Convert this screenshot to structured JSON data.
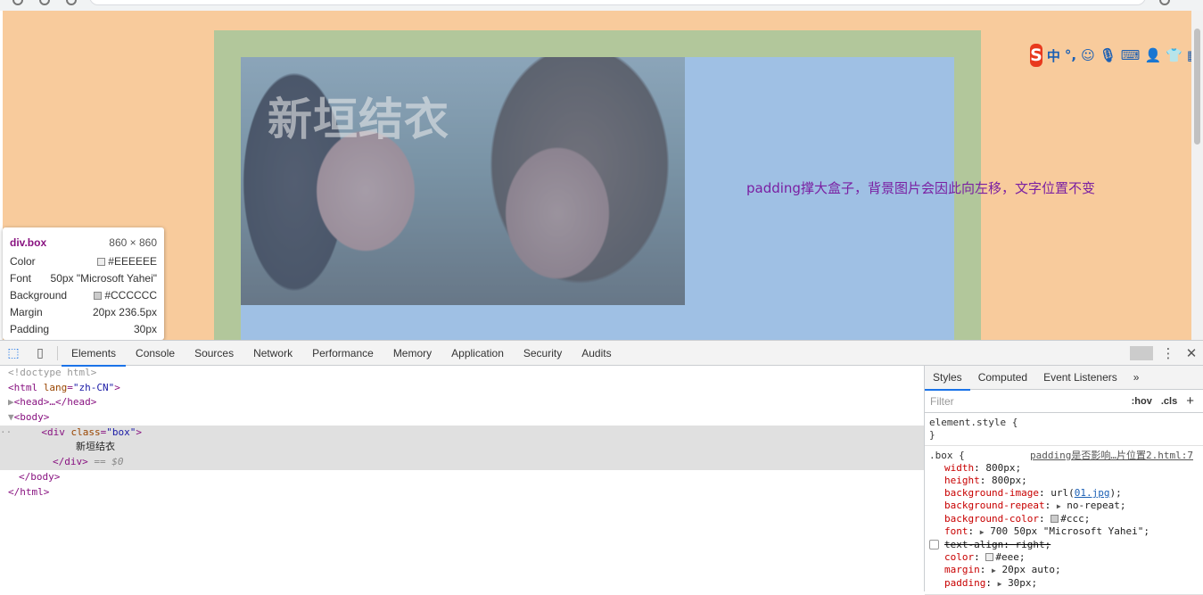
{
  "page": {
    "box_text": "新垣结衣",
    "caption": "padding撑大盒子，背景图片会因此向左移，文字位置不变"
  },
  "ime": {
    "logo": "S",
    "mode": "中",
    "punct": "°,"
  },
  "tooltip": {
    "selector": "div.box",
    "size": "860 × 860",
    "rows": [
      {
        "label": "Color",
        "value": "#EEEEEE",
        "swatch": "#eeeeee"
      },
      {
        "label": "Font",
        "value": "50px \"Microsoft Yahei\""
      },
      {
        "label": "Background",
        "value": "#CCCCCC",
        "swatch": "#cccccc"
      },
      {
        "label": "Margin",
        "value": "20px 236.5px"
      },
      {
        "label": "Padding",
        "value": "30px"
      }
    ]
  },
  "devtools": {
    "tabs": [
      "Elements",
      "Console",
      "Sources",
      "Network",
      "Performance",
      "Memory",
      "Application",
      "Security",
      "Audits"
    ],
    "active_tab": "Elements",
    "elements": {
      "doctype": "<!doctype html>",
      "html_open": "<html",
      "html_lang_attr": "lang",
      "html_lang_val": "\"zh-CN\"",
      "head": "<head>…</head>",
      "body_open": "<body>",
      "div_open": "<div",
      "div_class_attr": "class",
      "div_class_val": "\"box\"",
      "div_text": "新垣结衣",
      "div_close": "</div>",
      "eq_marker": "== $0",
      "body_close": "</body>",
      "html_close": "</html>"
    },
    "styles": {
      "tabs": [
        "Styles",
        "Computed",
        "Event Listeners"
      ],
      "more": "»",
      "filter_placeholder": "Filter",
      "hov": ":hov",
      "cls": ".cls",
      "plus": "+",
      "element_style": "element.style {",
      "close_brace": "}",
      "rule_selector": ".box {",
      "rule_source": "padding是否影响…片位置2.html:7",
      "props": [
        {
          "name": "width",
          "value": "800px;"
        },
        {
          "name": "height",
          "value": "800px;"
        },
        {
          "name": "background-image",
          "value_pre": "url(",
          "value_link": "01.jpg",
          "value_post": ");"
        },
        {
          "name": "background-repeat",
          "value": "no-repeat;",
          "tri": true
        },
        {
          "name": "background-color",
          "value": "#ccc;",
          "swatch": "#cccccc"
        },
        {
          "name": "font",
          "value": "700 50px \"Microsoft Yahei\";",
          "tri": true
        },
        {
          "name": "text-align",
          "value": "right;",
          "disabled": true
        },
        {
          "name": "color",
          "value": "#eee;",
          "swatch": "#eeeeee"
        },
        {
          "name": "margin",
          "value": "20px auto;",
          "tri": true
        },
        {
          "name": "padding",
          "value": "30px;",
          "tri": true
        }
      ]
    }
  }
}
